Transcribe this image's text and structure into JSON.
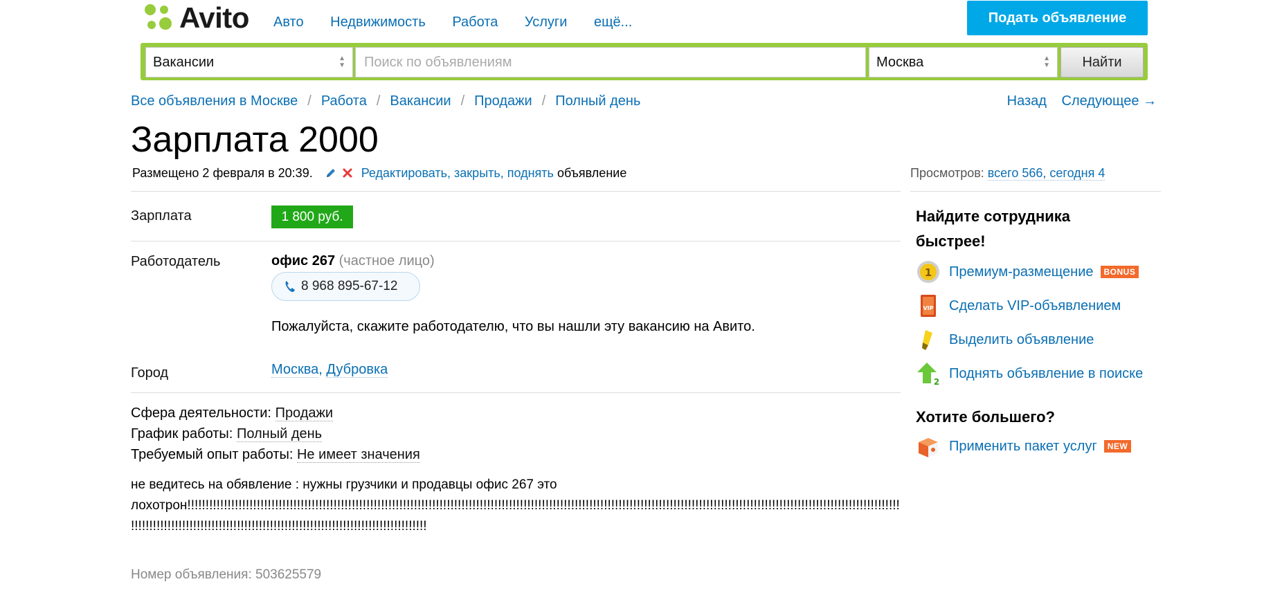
{
  "header": {
    "logo_text": "Avito",
    "nav": [
      "Авто",
      "Недвижимость",
      "Работа",
      "Услуги",
      "ещё..."
    ],
    "post_button": "Подать объявление",
    "brand_green": "#97cc3c",
    "brand_blue": "#00a8e8"
  },
  "search": {
    "category": "Вакансии",
    "placeholder": "Поиск по объявлениям",
    "city": "Москва",
    "button": "Найти"
  },
  "breadcrumbs": [
    "Все объявления в Москве",
    "Работа",
    "Вакансии",
    "Продажи",
    "Полный день"
  ],
  "breadcrumb_separator": "/",
  "pager": {
    "back": "Назад",
    "next": "Следующее →"
  },
  "listing": {
    "title": "Зарплата 2000",
    "posted": "Размещено 2 февраля в 20:39.",
    "actions": "Редактировать, закрыть, поднять",
    "actions_suffix": " объявление",
    "views_label": "Просмотров:",
    "views_value": "всего 566, сегодня 4",
    "salary_label": "Зарплата",
    "salary": "1 800 руб.",
    "employer_label": "Работодатель",
    "employer_name": "офис 267",
    "employer_type": "(частное лицо)",
    "phone": "8 968 895-67-12",
    "notice": "Пожалуйста, скажите работодателю, что вы нашли эту вакансию на Авито.",
    "city_label": "Город",
    "city_main": "Москва",
    "city_district": "Дубровка",
    "params": [
      {
        "label": "Сфера деятельности:",
        "value": "Продажи"
      },
      {
        "label": "График работы:",
        "value": "Полный день"
      },
      {
        "label": "Требуемый опыт работы:",
        "value": "Не имеет значения"
      }
    ],
    "description_line1": "не ведитесь на обявление : нужны грузчики и продавцы офис 267 это",
    "description_line2": "лохотрон!!!!!!!!!!!!!!!!!!!!!!!!!!!!!!!!!!!!!!!!!!!!!!!!!!!!!!!!!!!!!!!!!!!!!!!!!!!!!!!!!!!!!!!!!!!!!!!!!!!!!!!!!!!!!!!!!!!!!!!!!!!!!!!!!!!!!!!!!!!!!!!!!!!!!!!!!!!!!!!!!!!!!!!!!!!!!!!!!!!!!!!!!!!!!!!!!!!!!!!!!!!!!!!!!!!!!!!!!!!",
    "description_line3": "!!!!!!!!!!!!!!!!!!!!!!!!!!!!!!!!!!!!!!!!!!!!!!!!!!!!!!!!!!!!!!!!!!!!!!!!!!!!!!!!!",
    "ad_number": "Номер объявления: 503625579"
  },
  "sidebar": {
    "heading1_line1": "Найдите сотрудника",
    "heading1_line2": "быстрее!",
    "items": [
      {
        "label": "Премиум-размещение",
        "badge": "BONUS",
        "icon": "medal-icon"
      },
      {
        "label": "Сделать VIP-объявлением",
        "badge": "",
        "icon": "vip-icon"
      },
      {
        "label": "Выделить объявление",
        "badge": "",
        "icon": "highlighter-icon"
      },
      {
        "label": "Поднять объявление в поиске",
        "badge": "",
        "icon": "up-arrow-icon"
      }
    ],
    "heading2": "Хотите большего?",
    "package": {
      "label": "Применить пакет услуг",
      "badge": "NEW",
      "icon": "gift-box-icon"
    }
  }
}
